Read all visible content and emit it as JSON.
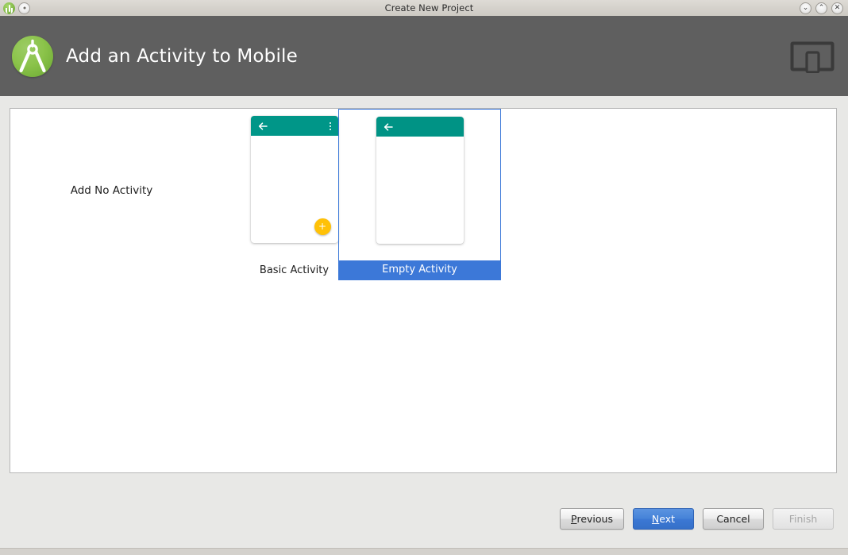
{
  "window": {
    "title": "Create New Project",
    "app_icon": "android-studio-icon",
    "menu_icon": "window-menu-icon",
    "controls": [
      {
        "name": "minimize-button",
        "glyph": "⌄"
      },
      {
        "name": "maximize-button",
        "glyph": "⌃"
      },
      {
        "name": "close-button",
        "glyph": "✕"
      }
    ]
  },
  "header": {
    "title": "Add an Activity to Mobile",
    "logo_icon": "android-studio-logo",
    "device_icon": "tablet-and-phone-icon",
    "background_color": "#5f5f5f"
  },
  "gallery": {
    "no_activity_label": "Add No Activity",
    "tiles": [
      {
        "label": "Basic Activity",
        "selected": false,
        "appbar_color": "#009688",
        "has_back_arrow": true,
        "has_overflow_menu": true,
        "has_fab": true,
        "fab_color": "#ffc107",
        "fab_glyph": "+"
      },
      {
        "label": "Empty Activity",
        "selected": true,
        "appbar_color": "#009385",
        "has_back_arrow": true,
        "has_overflow_menu": false,
        "has_fab": false,
        "fab_color": "",
        "fab_glyph": ""
      }
    ],
    "selection_color": "#3c78d8"
  },
  "footer": {
    "buttons": [
      {
        "name": "previous-button",
        "label": "Previous",
        "mnemonic": "P",
        "style": "normal"
      },
      {
        "name": "next-button",
        "label": "Next",
        "mnemonic": "N",
        "style": "primary"
      },
      {
        "name": "cancel-button",
        "label": "Cancel",
        "mnemonic": "",
        "style": "normal"
      },
      {
        "name": "finish-button",
        "label": "Finish",
        "mnemonic": "",
        "style": "disabled"
      }
    ]
  }
}
